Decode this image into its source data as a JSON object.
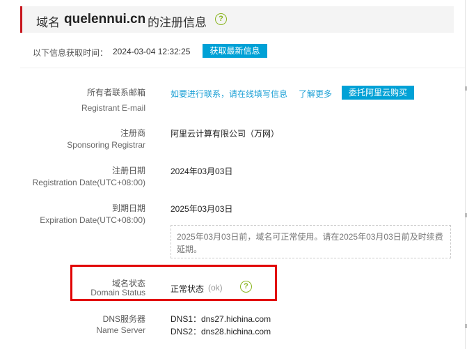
{
  "header": {
    "prefix": "域名",
    "domain": "quelennui.cn",
    "suffix": "的注册信息",
    "help_icon": "question-circle-icon"
  },
  "fetch": {
    "label": "以下信息获取时间：",
    "time": "2024-03-04 12:32:25",
    "refresh_button": "获取最新信息"
  },
  "rows": {
    "email": {
      "label_cn": "所有者联系邮箱",
      "label_en": "Registrant E-mail",
      "contact_link": "如要进行联系，请在线填写信息",
      "learn_more": "了解更多",
      "buy_button": "委托阿里云购买"
    },
    "registrar": {
      "label_cn": "注册商",
      "label_en": "Sponsoring Registrar",
      "value": "阿里云计算有限公司（万网）"
    },
    "registration": {
      "label_cn": "注册日期",
      "label_en": "Registration Date(UTC+08:00)",
      "value": "2024年03月03日"
    },
    "expiration": {
      "label_cn": "到期日期",
      "label_en": "Expiration Date(UTC+08:00)",
      "value": "2025年03月03日",
      "notice": "2025年03月03日前，域名可正常使用。请在2025年03月03日前及时续费延期。"
    },
    "status": {
      "label_cn": "域名状态",
      "label_en": "Domain Status",
      "value": "正常状态",
      "code": "(ok)",
      "help_icon": "question-circle-icon"
    },
    "nameserver": {
      "label_cn": "DNS服务器",
      "label_en": "Name Server",
      "dns1": "DNS1：dns27.hichina.com",
      "dns2": "DNS2：dns28.hichina.com"
    }
  },
  "colors": {
    "accent": "#00a1d6",
    "link": "#1a9fd5",
    "header_bar": "#c8161d",
    "highlight_box": "#e10000",
    "help_icon": "#8ab520"
  }
}
